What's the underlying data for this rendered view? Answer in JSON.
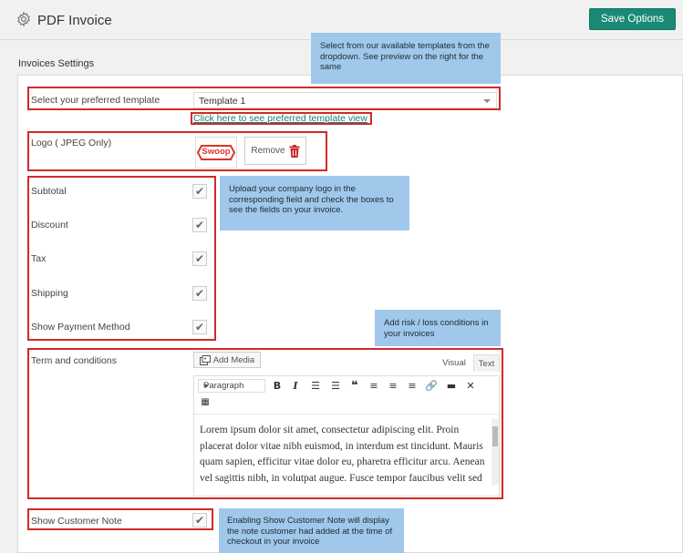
{
  "header": {
    "title": "PDF Invoice",
    "save_label": "Save Options"
  },
  "section": {
    "title": "Invoices Settings"
  },
  "template": {
    "label": "Select your preferred template",
    "value": "Template 1",
    "preview_link": "Click here to see preferred template view"
  },
  "logo": {
    "label": "Logo ( JPEG Only)",
    "logo_text": "Swoop",
    "remove_label": "Remove"
  },
  "options": [
    {
      "label": "Subtotal",
      "checked": true
    },
    {
      "label": "Discount",
      "checked": true
    },
    {
      "label": "Tax",
      "checked": true
    },
    {
      "label": "Shipping",
      "checked": true
    },
    {
      "label": "Show Payment Method",
      "checked": true
    }
  ],
  "terms": {
    "label": "Term and conditions",
    "add_media": "Add Media",
    "tab_visual": "Visual",
    "tab_text": "Text",
    "format_select": "Paragraph",
    "content": "Lorem ipsum dolor sit amet, consectetur adipiscing elit. Proin placerat dolor vitae nibh euismod, in interdum est tincidunt. Mauris quam sapien, efficitur vitae dolor eu, pharetra efficitur arcu. Aenean vel sagittis nibh, in volutpat augue. Fusce tempor faucibus velit sed rhoncus. Donec dui"
  },
  "customer_note": {
    "label": "Show Customer Note",
    "checked": true
  },
  "tips": {
    "template": "Select from our available templates from the dropdown. See preview on the right for the same",
    "logo": "Upload your company logo in the corresponding field and check the boxes to see the fields on your invoice.",
    "terms": "Add risk / loss conditions in your invoices",
    "note": "Enabling Show Customer Note will display the note customer had added at the time of checkout in your invoice"
  },
  "colors": {
    "accent": "#1a8a76",
    "highlight": "#d12a2a",
    "tip_bg": "#9fc8ea"
  }
}
